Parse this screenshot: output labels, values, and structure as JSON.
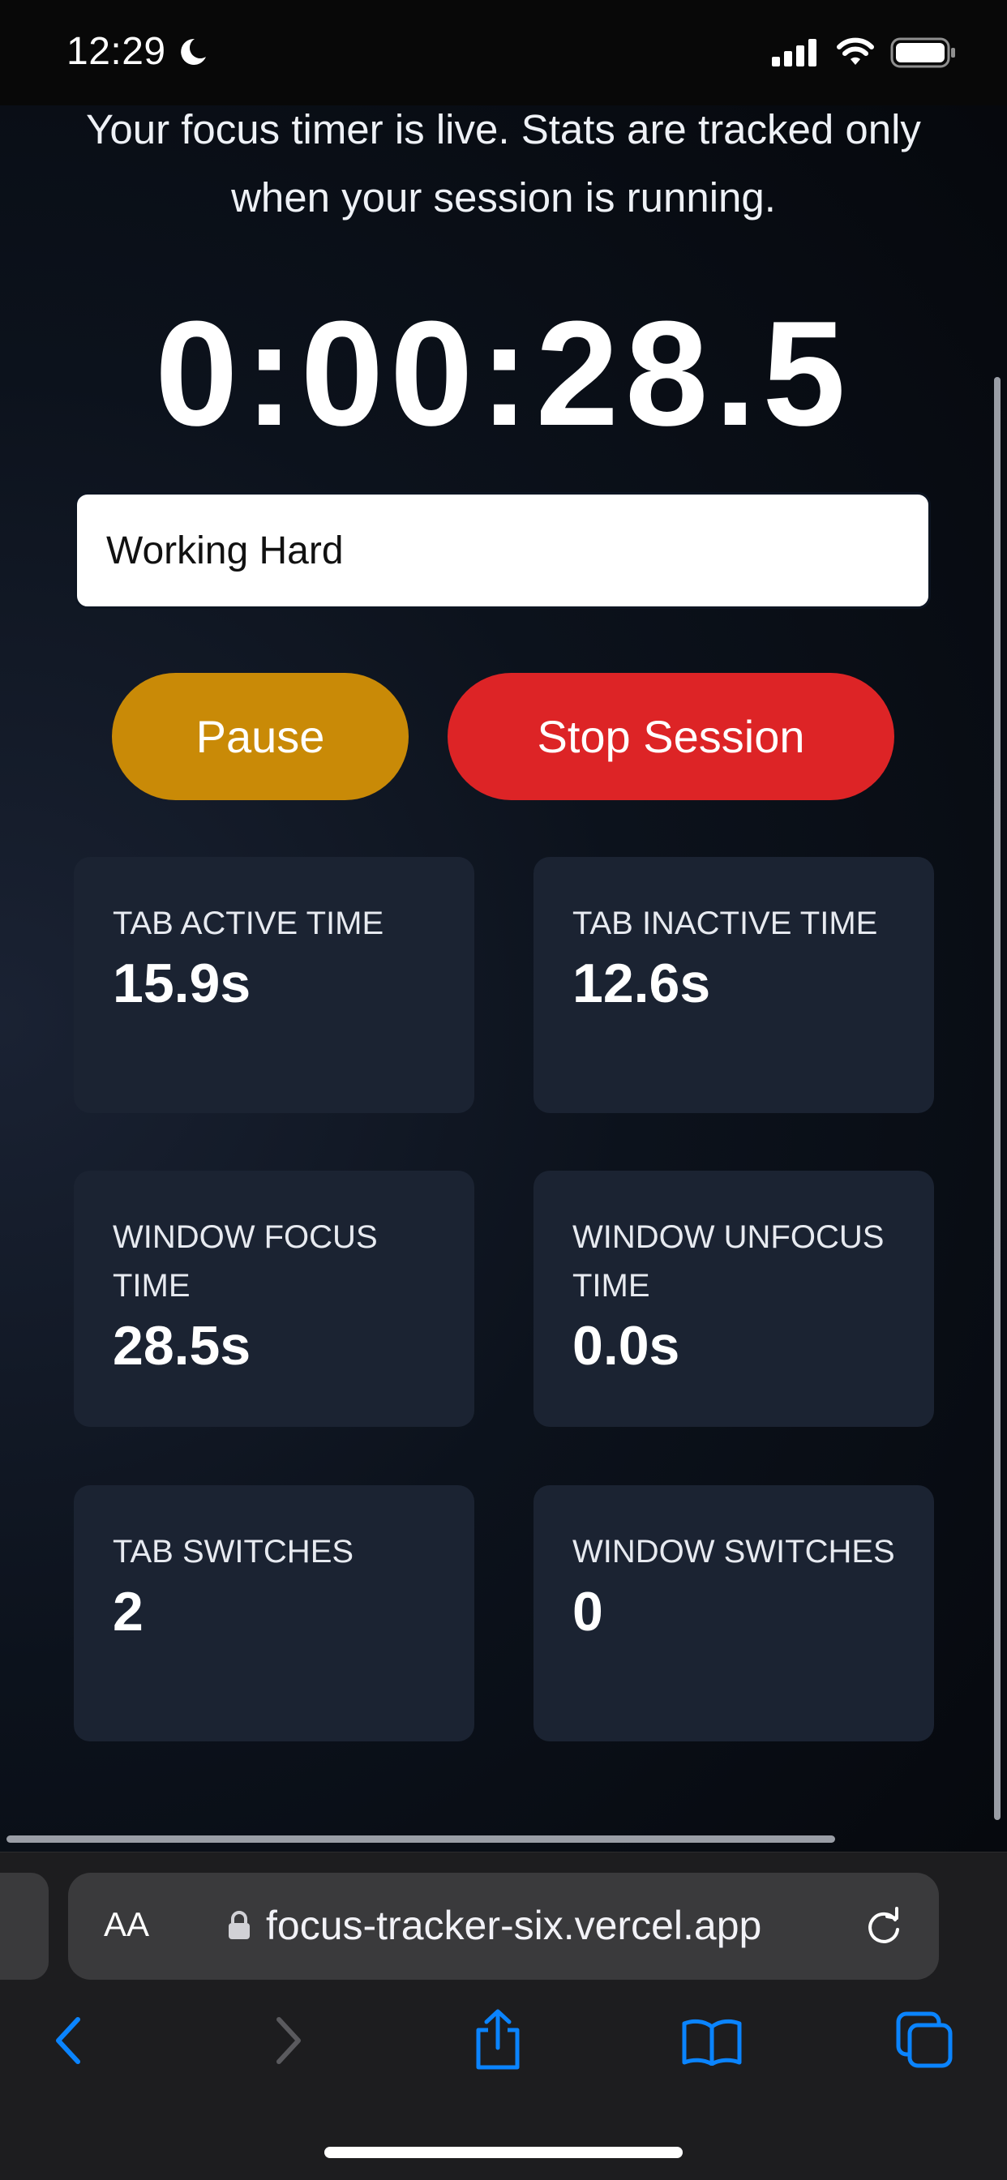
{
  "status_bar": {
    "time": "12:29"
  },
  "page": {
    "intro_text": "Your focus timer is live. Stats are tracked only when your session is running.",
    "timer": "0:00:28.5",
    "task_input": {
      "value": "Working Hard"
    },
    "buttons": {
      "pause": "Pause",
      "stop": "Stop Session"
    },
    "stats": [
      {
        "label": "TAB ACTIVE TIME",
        "value": "15.9s"
      },
      {
        "label": "TAB INACTIVE TIME",
        "value": "12.6s"
      },
      {
        "label": "WINDOW FOCUS TIME",
        "value": "28.5s"
      },
      {
        "label": "WINDOW UNFOCUS TIME",
        "value": "0.0s"
      },
      {
        "label": "TAB SWITCHES",
        "value": "2"
      },
      {
        "label": "WINDOW SWITCHES",
        "value": "0"
      }
    ]
  },
  "browser": {
    "text_size_label": "AA",
    "url": "focus-tracker-six.vercel.app"
  },
  "colors": {
    "pause": "#c98a07",
    "stop": "#dd2426",
    "card": "#1b2332",
    "ios_blue": "#0a84ff"
  }
}
